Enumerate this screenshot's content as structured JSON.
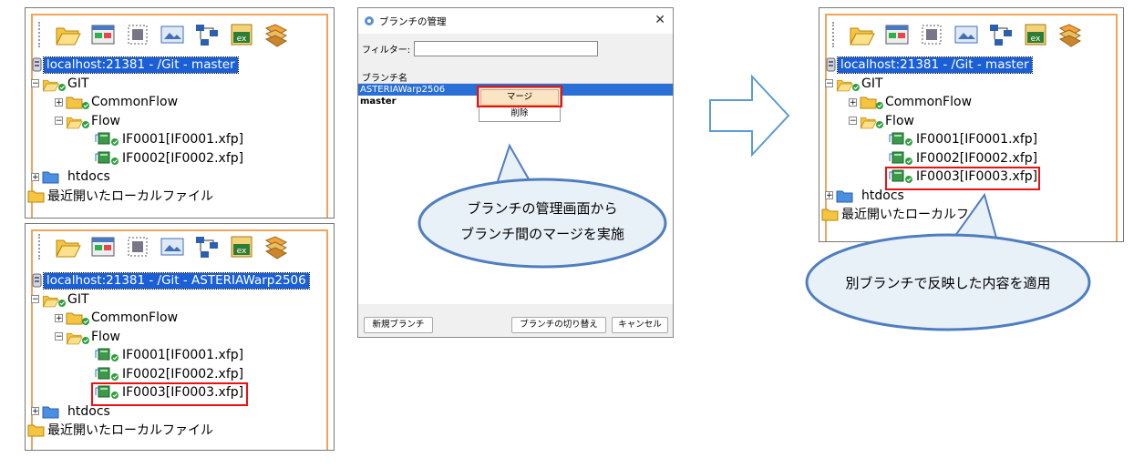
{
  "toolbar_icons": [
    "folder-open-icon",
    "window-icon",
    "resize-icon",
    "image-icon",
    "network-icon",
    "excel-icon",
    "flow-icon"
  ],
  "panel_before": {
    "root": "localhost:21381 - /Git - master",
    "git": "GIT",
    "commonflow": "CommonFlow",
    "flow": "Flow",
    "files": [
      "IF0001[IF0001.xfp]",
      "IF0002[IF0002.xfp]"
    ],
    "htdocs": "htdocs",
    "recent": "最近開いたローカルファイル"
  },
  "panel_branch": {
    "root": "localhost:21381 - /Git - ASTERIAWarp2506",
    "git": "GIT",
    "commonflow": "CommonFlow",
    "flow": "Flow",
    "files": [
      "IF0001[IF0001.xfp]",
      "IF0002[IF0002.xfp]",
      "IF0003[IF0003.xfp]"
    ],
    "htdocs": "htdocs",
    "recent": "最近開いたローカルファイル"
  },
  "panel_after": {
    "root": "localhost:21381 - /Git - master",
    "git": "GIT",
    "commonflow": "CommonFlow",
    "flow": "Flow",
    "files": [
      "IF0001[IF0001.xfp]",
      "IF0002[IF0002.xfp]",
      "IF0003[IF0003.xfp]"
    ],
    "htdocs": "htdocs",
    "recent": "最近開いたローカルファ"
  },
  "dialog": {
    "title": "ブランチの管理",
    "close": "✕",
    "filter_label": "フィルター:",
    "filter_value": "",
    "list_header": "ブランチ名",
    "branches": [
      "ASTERIAWarp2506",
      "master"
    ],
    "context_menu": {
      "merge": "マージ",
      "delete": "削除"
    },
    "buttons": {
      "new_branch": "新規ブランチ",
      "switch": "ブランチの切り替え",
      "cancel": "キャンセル"
    }
  },
  "callouts": {
    "dialog_line1": "ブランチの管理画面から",
    "dialog_line2": "ブランチ間のマージを実施",
    "result": "別ブランチで反映した内容を適用"
  },
  "colors": {
    "accent_orange": "#f3a35a",
    "selection": "#1a5fd6",
    "highlight": "#e11111",
    "bubble_fill": "#e8f0f8",
    "bubble_stroke": "#4f7ec0",
    "arrow": "#5b9bd5"
  }
}
